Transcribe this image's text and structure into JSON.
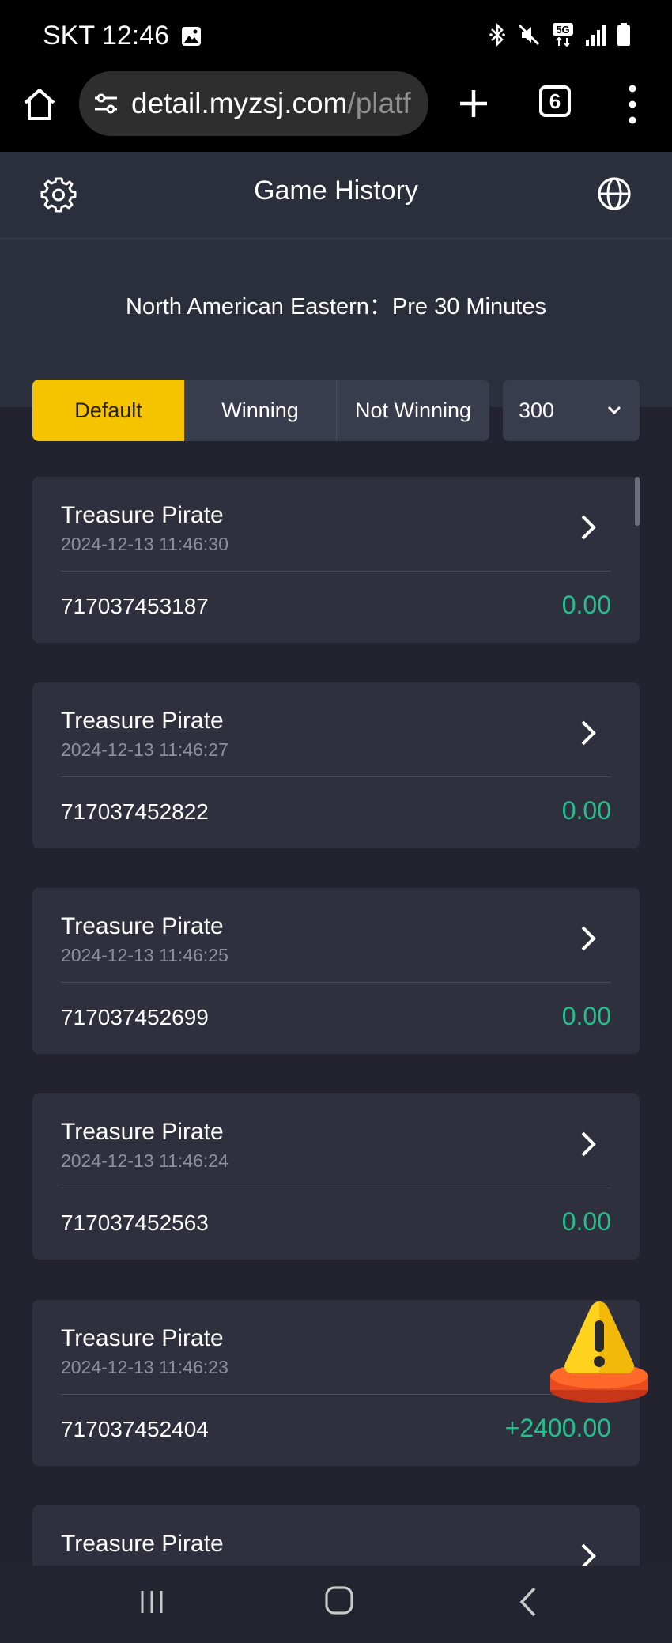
{
  "status_bar": {
    "carrier": "SKT",
    "time": "12:46",
    "icons": [
      "gallery-icon",
      "bluetooth-icon",
      "mute-icon",
      "5g-icon",
      "signal-icon",
      "battery-icon"
    ],
    "network_label": "5G"
  },
  "browser": {
    "url_host": "detail.myzsj.com",
    "url_path": "/platf",
    "tab_count": "6"
  },
  "header": {
    "title": "Game History"
  },
  "timezone_label": "North American Eastern：Pre 30 Minutes",
  "filters": {
    "tabs": [
      {
        "label": "Default",
        "active": true
      },
      {
        "label": "Winning",
        "active": false
      },
      {
        "label": "Not Winning",
        "active": false
      }
    ],
    "count_value": "300"
  },
  "records": [
    {
      "game": "Treasure Pirate",
      "time": "2024-12-13 11:46:30",
      "round_id": "717037453187",
      "amount": "0.00"
    },
    {
      "game": "Treasure Pirate",
      "time": "2024-12-13 11:46:27",
      "round_id": "717037452822",
      "amount": "0.00"
    },
    {
      "game": "Treasure Pirate",
      "time": "2024-12-13 11:46:25",
      "round_id": "717037452699",
      "amount": "0.00"
    },
    {
      "game": "Treasure Pirate",
      "time": "2024-12-13 11:46:24",
      "round_id": "717037452563",
      "amount": "0.00"
    },
    {
      "game": "Treasure Pirate",
      "time": "2024-12-13 11:46:23",
      "round_id": "717037452404",
      "amount": "+2400.00"
    },
    {
      "game": "Treasure Pirate",
      "time": "",
      "round_id": "",
      "amount": ""
    }
  ],
  "colors": {
    "accent": "#f6c300",
    "amount_green": "#23c08c",
    "card_bg": "#2e303e",
    "page_bg": "#22232e"
  }
}
